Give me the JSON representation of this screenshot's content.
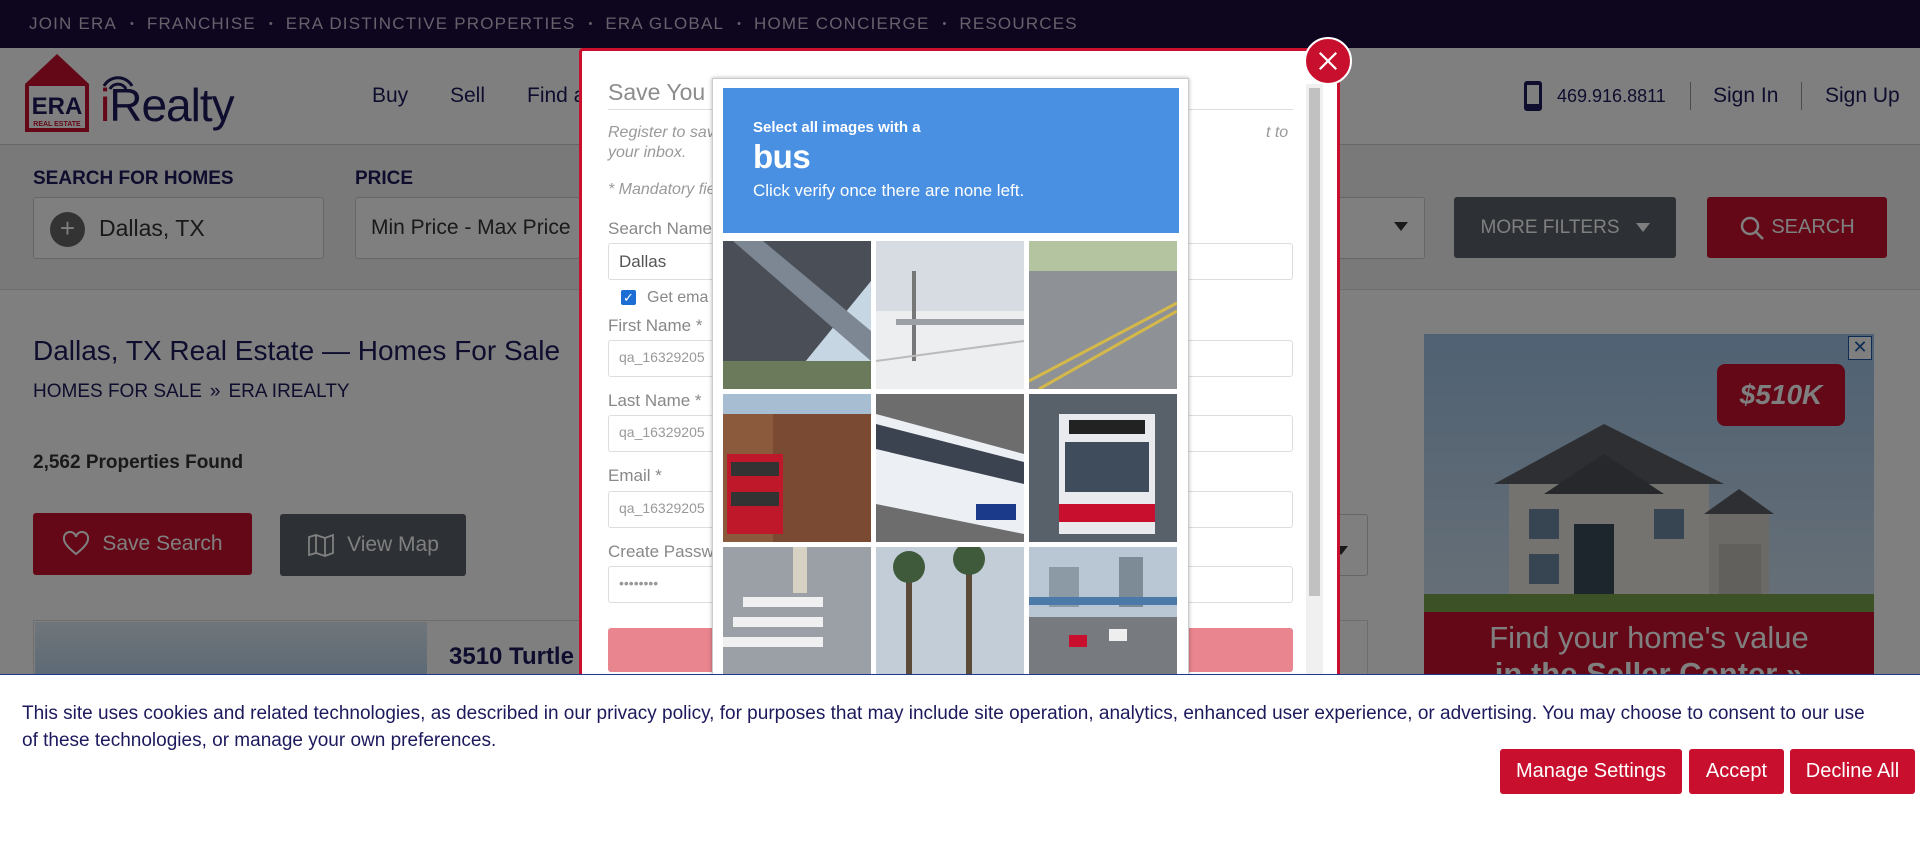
{
  "topbar": {
    "items": [
      "JOIN ERA",
      "FRANCHISE",
      "ERA DISTINCTIVE PROPERTIES",
      "ERA GLOBAL",
      "HOME CONCIERGE",
      "RESOURCES"
    ],
    "separator": "•"
  },
  "header": {
    "logo_era": "ERA",
    "logo_era_sub": "REAL ESTATE",
    "logo_irealty": "Realty",
    "logo_i": "i",
    "nav": [
      "Buy",
      "Sell",
      "Find a"
    ],
    "phone": "469.916.8811",
    "sign_in": "Sign In",
    "sign_up": "Sign Up"
  },
  "search_strip": {
    "location_label": "SEARCH FOR HOMES",
    "location_value": "Dallas, TX",
    "price_label": "PRICE",
    "price_value": "Min Price  -  Max Price",
    "more_filters": "MORE FILTERS",
    "search": "SEARCH"
  },
  "page": {
    "title": "Dallas, TX Real Estate — Homes For Sale",
    "breadcrumb": [
      "HOMES FOR SALE",
      "ERA IREALTY"
    ],
    "breadcrumb_sep": "»",
    "count": "2,562 Properties Found",
    "save_search": "Save Search",
    "view_map": "View Map",
    "listing_title": "3510 Turtle"
  },
  "ad": {
    "price": "$510K",
    "text_line1": "Find your home's value",
    "text_line2": "in the Seller Center »",
    "close": "✕"
  },
  "modal": {
    "title": "Save You",
    "subtitle": "Register to save                                                                                                                          t to your inbox.",
    "mandatory": "* Mandatory fie",
    "fields": {
      "search_name_label": "Search Name",
      "search_name_value": "Dallas",
      "email_alerts_label": "Get ema",
      "first_name_label": "First Name *",
      "first_name_value": "qa_16329205",
      "last_name_label": "Last Name *",
      "last_name_value": "qa_16329205",
      "email_label": "Email *",
      "email_value": "qa_16329205",
      "password_label": "Create Passw",
      "password_value": "••••••••"
    }
  },
  "captcha": {
    "line1": "Select all images with a",
    "target": "bus",
    "line3": "Click verify once there are none left."
  },
  "cookie": {
    "text": "This site uses cookies and related technologies, as described in our privacy policy, for purposes that may include site operation, analytics, enhanced user experience, or advertising. You may choose to consent to our use of these technologies, or manage your own preferences.",
    "manage": "Manage Settings",
    "accept": "Accept",
    "decline": "Decline All"
  },
  "colors": {
    "brand_red": "#c8102e",
    "navy": "#1c1a5c",
    "topbar": "#1c0a3e",
    "captcha_blue": "#4a90e2"
  }
}
